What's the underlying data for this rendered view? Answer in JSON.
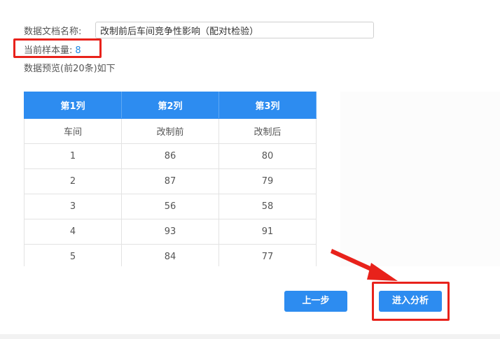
{
  "form": {
    "name_label": "数据文档名称:",
    "name_value": "改制前后车间竞争性影响（配对t检验）",
    "sample_label": "当前样本量:",
    "sample_value": "8",
    "preview_label": "数据预览(前20条)如下"
  },
  "table": {
    "headers": [
      "第1列",
      "第2列",
      "第3列"
    ],
    "rows": [
      [
        "车间",
        "改制前",
        "改制后"
      ],
      [
        "1",
        "86",
        "80"
      ],
      [
        "2",
        "87",
        "79"
      ],
      [
        "3",
        "56",
        "58"
      ],
      [
        "4",
        "93",
        "91"
      ],
      [
        "5",
        "84",
        "77"
      ]
    ]
  },
  "buttons": {
    "prev_label": "上一步",
    "next_label": "进入分析"
  },
  "colors": {
    "accent": "#2d8cf0",
    "highlight": "#e8221b"
  }
}
